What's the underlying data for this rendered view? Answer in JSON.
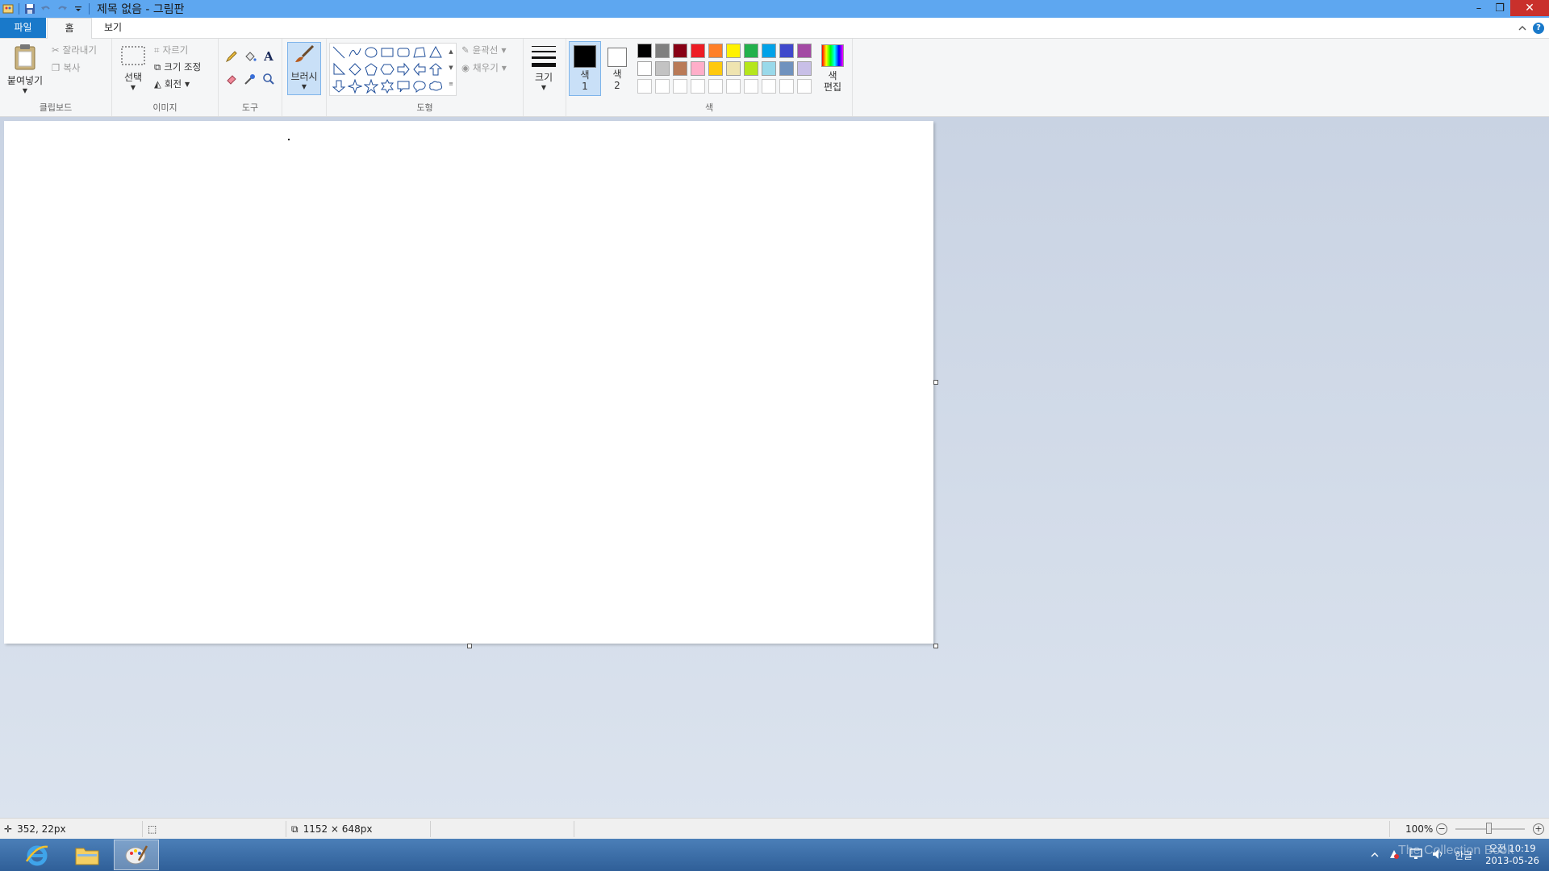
{
  "window": {
    "title": "제목 없음 - 그림판",
    "controls": {
      "minimize": "–",
      "restore": "❐",
      "close": "✕"
    }
  },
  "tabs": {
    "file": "파일",
    "home": "홈",
    "view": "보기",
    "help": "?"
  },
  "ribbon": {
    "clipboard": {
      "label": "클립보드",
      "paste": "붙여넣기",
      "cut": "잘라내기",
      "copy": "복사"
    },
    "image": {
      "label": "이미지",
      "select": "선택",
      "crop": "자르기",
      "resize": "크기 조정",
      "rotate": "회전"
    },
    "tools": {
      "label": "도구"
    },
    "brush": {
      "label": "브러시"
    },
    "shapes": {
      "label": "도형",
      "outline": "윤곽선",
      "fill": "채우기"
    },
    "size": {
      "label": "크기"
    },
    "colors": {
      "label": "색",
      "color1": "색\n1",
      "color2": "색\n2",
      "edit": "색\n편집",
      "color1_value": "#000000",
      "color2_value": "#ffffff",
      "palette_row1": [
        "#000000",
        "#7f7f7f",
        "#880015",
        "#ed1c24",
        "#ff7f27",
        "#fff200",
        "#22b14c",
        "#00a2e8",
        "#3f48cc",
        "#a349a4"
      ],
      "palette_row2": [
        "#ffffff",
        "#c3c3c3",
        "#b97a57",
        "#ffaec9",
        "#ffc90e",
        "#efe4b0",
        "#b5e61d",
        "#99d9ea",
        "#7092be",
        "#c8bfe7"
      ]
    }
  },
  "status": {
    "cursor_pos": "352, 22px",
    "image_size": "1152 × 648px",
    "zoom": "100%"
  },
  "taskbar": {
    "ime": "한글",
    "time": "오전 10:19",
    "date": "2013-05-26",
    "watermark": "The Collection Book"
  }
}
